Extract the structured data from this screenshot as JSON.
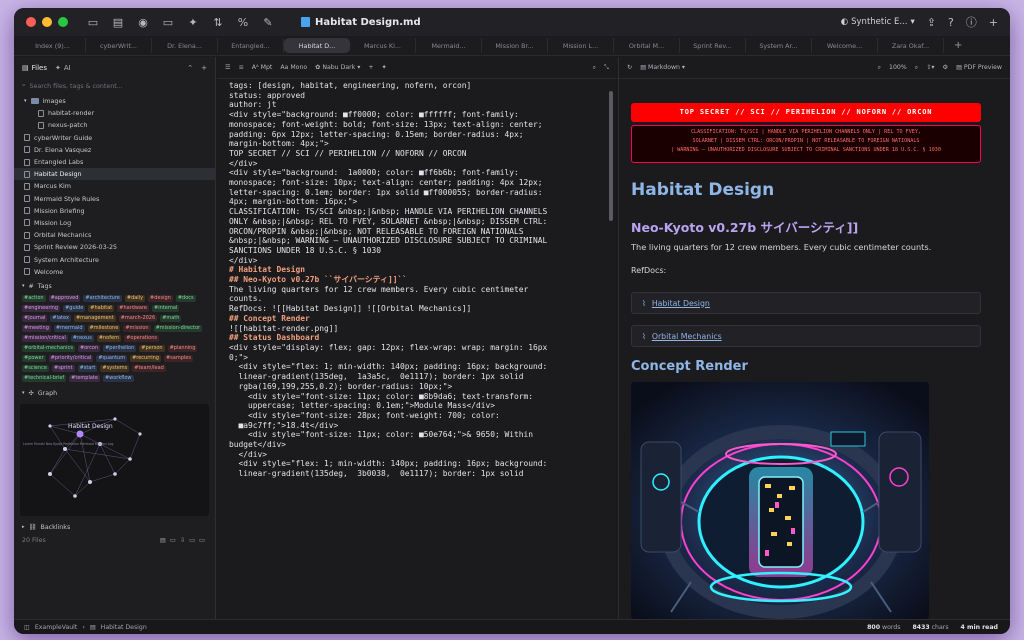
{
  "window": {
    "title": "Habitat Design.md",
    "theme": "Synthetic E..."
  },
  "tabs": [
    "Index (9)...",
    "cyberWrit...",
    "Dr. Elena...",
    "Entangled...",
    "Habitat D...",
    "Marcus Ki...",
    "Mermaid...",
    "Mission Br...",
    "Mission L...",
    "Orbital M...",
    "Sprint Rev...",
    "System Ar...",
    "Welcome...",
    "Zara Okaf..."
  ],
  "sidebar": {
    "tab_files": "Files",
    "tab_ai": "AI",
    "search_placeholder": "Search files, tags & content...",
    "folder": "images",
    "folder_items": [
      "habitat-render",
      "nexus-patch"
    ],
    "files": [
      "cyberWriter Guide",
      "Dr. Elena Vasquez",
      "Entangled Labs",
      "Habitat Design",
      "Marcus Kim",
      "Mermaid Style Rules",
      "Mission Briefing",
      "Mission Log",
      "Orbital Mechanics",
      "Sprint Review 2026-03-25",
      "System Architecture",
      "Welcome"
    ],
    "tags_label": "Tags",
    "tags": [
      "#action",
      "#approved",
      "#architecture",
      "#daily",
      "#design",
      "#docs",
      "#engineering",
      "#guide",
      "#habitat",
      "#hardware",
      "#internal",
      "#journal",
      "#latex",
      "#management",
      "#march-2026",
      "#math",
      "#meeting",
      "#mermaid",
      "#milestone",
      "#mission",
      "#mission-director",
      "#mission/critical",
      "#nexus",
      "#nofern",
      "#operations",
      "#orbital-mechanics",
      "#orcon",
      "#perihelion",
      "#person",
      "#planning",
      "#power",
      "#priority/critical",
      "#quantum",
      "#recurring",
      "#samples",
      "#science",
      "#sprint",
      "#start",
      "#systems",
      "#team/lead",
      "#technical-brief",
      "#template",
      "#workflow"
    ],
    "graph_label": "Graph",
    "graph_node": "Habitat Design",
    "graph_sub": "Lorem Muraki  Neo-Kyoto  Perihelion  Mermaid  Mission Log",
    "backlinks_label": "Backlinks",
    "backlinks_count": "20 Files",
    "vault": "ExampleVault",
    "bottom_file": "Habitat Design"
  },
  "editor": {
    "font_size": "Mpt",
    "mono": "Mono",
    "theme": "Nabu Dark",
    "lines": [
      "tags: [design, habitat, engineering, nofern, orcon]",
      "status: approved",
      "author: jt",
      "",
      "<div style=\"background: ■ff0000; color: ■ffffff; font-family:",
      "monospace; font-weight: bold; font-size: 13px; text-align: center;",
      "padding: 6px 12px; letter-spacing: 0.15em; border-radius: 4px;",
      "margin-bottom: 4px;\">",
      "TOP SECRET // SCI // PERIHELION // NOFORN // ORCON",
      "</div>",
      "",
      "<div style=\"background:  1a0000; color: ■ff6b6b; font-family:",
      "monospace; font-size: 10px; text-align: center; padding: 4px 12px;",
      "letter-spacing: 0.1em; border: 1px solid ■ff000055; border-radius:",
      "4px; margin-bottom: 16px;\">",
      "CLASSIFICATION: TS/SCI &nbsp;|&nbsp; HANDLE VIA PERIHELION CHANNELS",
      "ONLY &nbsp;|&nbsp; REL TO FVEY, SOLARNET &nbsp;|&nbsp; DISSEM CTRL:",
      "ORCON/PROPIN &nbsp;|&nbsp; NOT RELEASABLE TO FOREIGN NATIONALS",
      "&nbsp;|&nbsp; WARNING — UNAUTHORIZED DISCLOSURE SUBJECT TO CRIMINAL",
      "SANCTIONS UNDER 18 U.S.C. § 1030",
      "",
      "",
      "</div>",
      "",
      "# Habitat Design",
      "## Neo-Kyoto v0.27b ``サイバーシティ]]``",
      "",
      "The living quarters for 12 crew members. Every cubic centimeter",
      "counts.",
      "",
      "RefDocs: ![[Habitat Design]] ![[Orbital Mechanics]]",
      "",
      "## Concept Render",
      "",
      "![[habitat-render.png]]",
      "",
      "## Status Dashboard",
      "",
      "<div style=\"display: flex; gap: 12px; flex-wrap: wrap; margin: 16px",
      "0;\">",
      "  <div style=\"flex: 1; min-width: 140px; padding: 16px; background:",
      "  linear-gradient(135deg,  1a3a5c,  0e1117); border: 1px solid",
      "  rgba(169,199,255,0.2); border-radius: 10px;\">",
      "    <div style=\"font-size: 11px; color: ■8b9da6; text-transform:",
      "    uppercase; letter-spacing: 0.1em;\">Module Mass</div>",
      "    <div style=\"font-size: 28px; font-weight: 700; color:",
      "  ■a9c7ff;\">18.4t</div>",
      "    <div style=\"font-size: 11px; color: ■50e764;\">& 9650; Within",
      "budget</div>",
      "  </div>",
      "  <div style=\"flex: 1; min-width: 140px; padding: 16px; background:",
      "  linear-gradient(135deg,  3b0038,  0e1117); border: 1px solid"
    ]
  },
  "preview": {
    "mode": "Markdown",
    "zoom": "100%",
    "pdf": "PDF Preview",
    "banner": "TOP SECRET // SCI // PERIHELION // NOFORN // ORCON",
    "class1": "CLASSIFICATION: TS/SCI  |  HANDLE VIA PERIHELION CHANNELS ONLY  |  REL TO FVEY,",
    "class2": "SOLARNET  |  DISSEM CTRL: ORCON/PROPIN  |  NOT RELEASABLE TO FOREIGN NATIONALS",
    "class3": "|  WARNING — UNAUTHORIZED DISCLOSURE SUBJECT TO CRIMINAL SANCTIONS UNDER 18 U.S.C. § 1030",
    "h1": "Habitat Design",
    "h2": "Neo-Kyoto v0.27b サイバーシティ]]",
    "p1": "The living quarters for 12 crew members. Every cubic centimeter counts.",
    "refdocs": "RefDocs:",
    "ref1": "Habitat Design",
    "ref2": "Orbital Mechanics",
    "h3": "Concept Render"
  },
  "status": {
    "vault": "ExampleVault",
    "file": "Habitat Design",
    "words": "800",
    "words_label": "words",
    "chars": "8433",
    "chars_label": "chars",
    "read": "4 min read"
  },
  "colors": {
    "accent": "#8fb6e6",
    "accent2": "#b9a3f3",
    "banner": "#ff0000"
  }
}
